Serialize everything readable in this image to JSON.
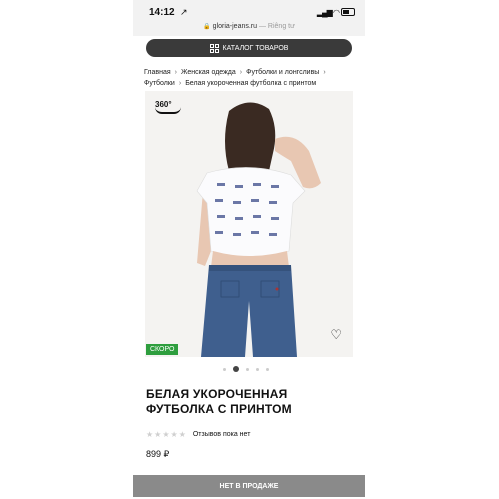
{
  "status_bar": {
    "time": "14:12",
    "location_arrow": "↗"
  },
  "url_bar": {
    "domain": "gloria-jeans.ru",
    "subtitle": "— Riêng tư"
  },
  "catalog_button": {
    "label": "КАТАЛОГ ТОВАРОВ"
  },
  "breadcrumbs": [
    "Главная",
    "Женская одежда",
    "Футболки и лонгсливы",
    "Футболки",
    "Белая укороченная футболка с принтом"
  ],
  "product": {
    "badge_360": "360°",
    "soon_badge": "СКОРО",
    "title": "БЕЛАЯ УКОРОЧЕННАЯ ФУТБОЛКА С ПРИНТОМ",
    "reviews_text": "Отзывов пока нет",
    "price": "899 ₽",
    "rating": 0,
    "max_rating": 5
  },
  "gallery": {
    "total": 5,
    "active_index": 1
  },
  "buy_button": {
    "label": "НЕТ В ПРОДАЖЕ"
  }
}
